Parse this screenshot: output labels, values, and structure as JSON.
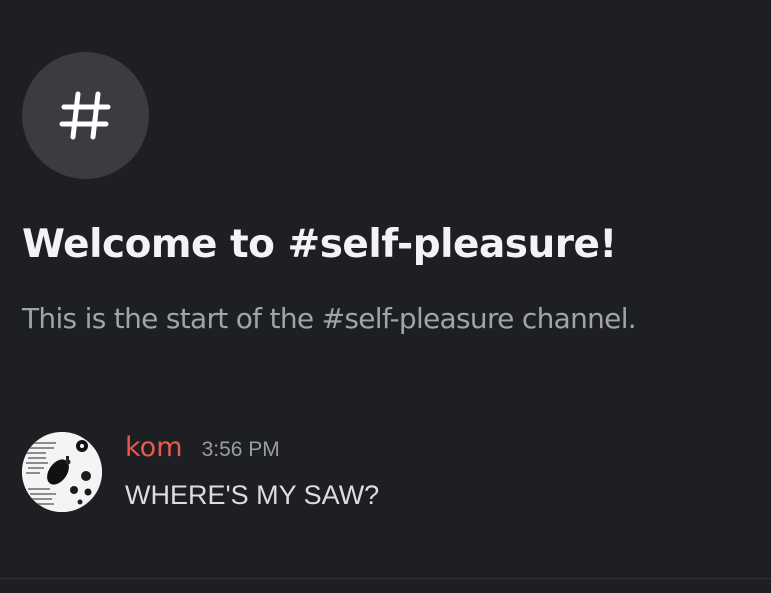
{
  "channel": {
    "icon": "hashtag-icon",
    "welcome_title": "Welcome to #self-pleasure!",
    "welcome_subtitle": "This is the start of the #self-pleasure channel."
  },
  "message": {
    "author": "kom",
    "timestamp": "3:56 PM",
    "content": "WHERE'S MY SAW?",
    "author_color": "#e8594e"
  },
  "colors": {
    "background": "#1e1f22",
    "icon_circle": "#3a3c42",
    "title": "#f2f3f5",
    "subtitle": "#a0a3aa",
    "timestamp": "#9a9ca3"
  }
}
